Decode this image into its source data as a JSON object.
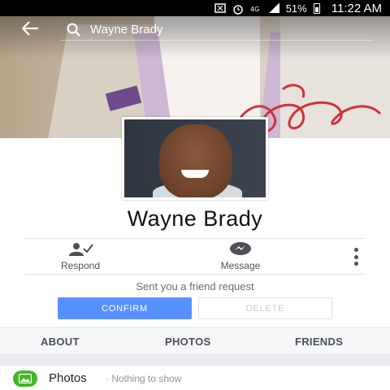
{
  "status_bar": {
    "battery": "51%",
    "time": "11:22 AM"
  },
  "header": {
    "search_text": "Wayne Brady"
  },
  "profile": {
    "name": "Wayne Brady"
  },
  "actions": {
    "respond_label": "Respond",
    "message_label": "Message"
  },
  "friend_request": {
    "text": "Sent you a friend request",
    "confirm_label": "CONFIRM",
    "delete_label": "DELETE"
  },
  "tabs": [
    {
      "label": "ABOUT"
    },
    {
      "label": "PHOTOS"
    },
    {
      "label": "FRIENDS"
    }
  ],
  "photos_section": {
    "title": "Photos",
    "subtitle": "· Nothing to show"
  },
  "colors": {
    "confirm_blue": "#5890ff",
    "photos_green": "#42b72a",
    "signature_red": "#d0323a"
  },
  "icons": {
    "back": "arrow-left-icon",
    "search": "search-icon",
    "respond": "person-check-icon",
    "message": "messenger-icon",
    "more": "vertical-dots-icon",
    "photos": "photo-icon"
  }
}
